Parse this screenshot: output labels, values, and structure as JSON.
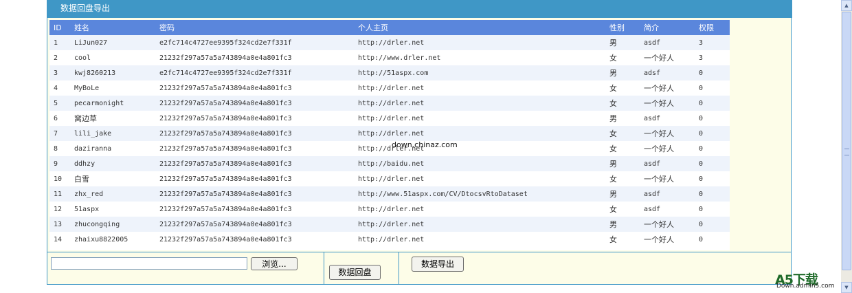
{
  "panel": {
    "title": "数据回盘导出"
  },
  "grid": {
    "headers": [
      "ID",
      "姓名",
      "密码",
      "个人主页",
      "性别",
      "简介",
      "权限"
    ],
    "rows": [
      [
        "1",
        "LiJun027",
        "e2fc714c4727ee9395f324cd2e7f331f",
        "http://drler.net",
        "男",
        "asdf",
        "3"
      ],
      [
        "2",
        "cool",
        "21232f297a57a5a743894a0e4a801fc3",
        "http://www.drler.net",
        "女",
        "一个好人",
        "3"
      ],
      [
        "3",
        "kwj8260213",
        "e2fc714c4727ee9395f324cd2e7f331f",
        "http://51aspx.com",
        "男",
        "adsf",
        "0"
      ],
      [
        "4",
        "MyBoLe",
        "21232f297a57a5a743894a0e4a801fc3",
        "http://drler.net",
        "女",
        "一个好人",
        "0"
      ],
      [
        "5",
        "pecarmonight",
        "21232f297a57a5a743894a0e4a801fc3",
        "http://drler.net",
        "女",
        "一个好人",
        "0"
      ],
      [
        "6",
        "窝边草",
        "21232f297a57a5a743894a0e4a801fc3",
        "http://drler.net",
        "男",
        "asdf",
        "0"
      ],
      [
        "7",
        "lili_jake",
        "21232f297a57a5a743894a0e4a801fc3",
        "http://drler.net",
        "女",
        "一个好人",
        "0"
      ],
      [
        "8",
        "daziranna",
        "21232f297a57a5a743894a0e4a801fc3",
        "http://drler.net",
        "女",
        "一个好人",
        "0"
      ],
      [
        "9",
        "ddhzy",
        "21232f297a57a5a743894a0e4a801fc3",
        "http://baidu.net",
        "男",
        "asdf",
        "0"
      ],
      [
        "10",
        "白雪",
        "21232f297a57a5a743894a0e4a801fc3",
        "http://drler.net",
        "女",
        "一个好人",
        "0"
      ],
      [
        "11",
        "zhx_red",
        "21232f297a57a5a743894a0e4a801fc3",
        "http://www.51aspx.com/CV/DtocsvRtoDataset",
        "男",
        "asdf",
        "0"
      ],
      [
        "12",
        "51aspx",
        "21232f297a57a5a743894a0e4a801fc3",
        "http://drler.net",
        "女",
        "asdf",
        "0"
      ],
      [
        "13",
        "zhucongqing",
        "21232f297a57a5a743894a0e4a801fc3",
        "http://drler.net",
        "男",
        "一个好人",
        "0"
      ],
      [
        "14",
        "zhaixu8822005",
        "21232f297a57a5a743894a0e4a801fc3",
        "http://drler.net",
        "女",
        "一个好人",
        "0"
      ]
    ]
  },
  "upload": {
    "value": "",
    "browse_label": "浏览..."
  },
  "actions": {
    "restore_label": "数据回盘",
    "export_label": "数据导出"
  },
  "watermark": {
    "center": "down.chinaz.com",
    "logo": "A5下载",
    "sub": "Down.admin5.com"
  },
  "scrollbar": {
    "up_icon": "scroll-up-arrow-icon",
    "down_icon": "scroll-down-arrow-icon"
  }
}
